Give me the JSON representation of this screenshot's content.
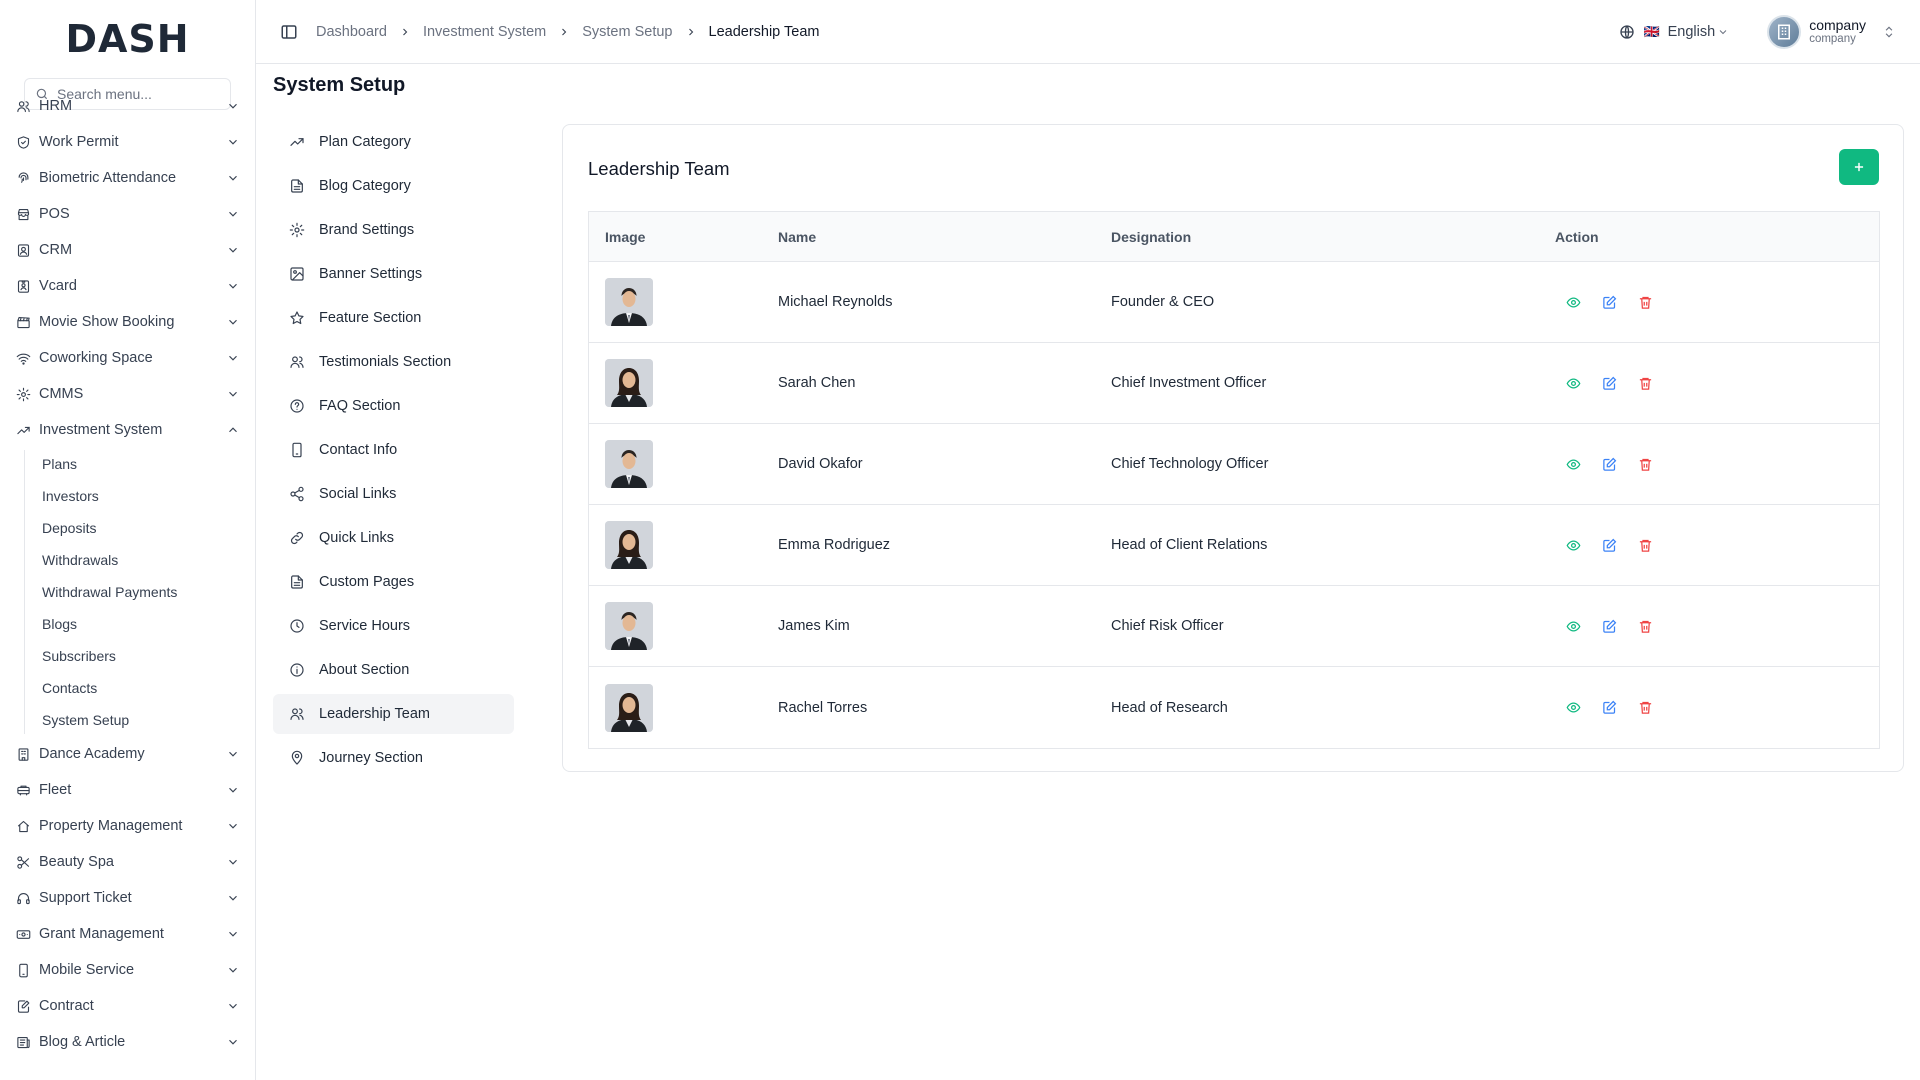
{
  "app": {
    "logo": "DASH",
    "search_placeholder": "Search menu..."
  },
  "sidebar": {
    "items": [
      {
        "label": "HRM",
        "icon": "users-icon"
      },
      {
        "label": "Work Permit",
        "icon": "shield-check-icon"
      },
      {
        "label": "Biometric Attendance",
        "icon": "fingerprint-icon"
      },
      {
        "label": "POS",
        "icon": "store-icon"
      },
      {
        "label": "CRM",
        "icon": "contact-icon"
      },
      {
        "label": "Vcard",
        "icon": "id-card-icon"
      },
      {
        "label": "Movie Show Booking",
        "icon": "clapper-icon"
      },
      {
        "label": "Coworking Space",
        "icon": "wifi-icon"
      },
      {
        "label": "CMMS",
        "icon": "gear-icon"
      },
      {
        "label": "Investment System",
        "icon": "trending-up-icon"
      },
      {
        "label": "Dance Academy",
        "icon": "building-icon"
      },
      {
        "label": "Fleet",
        "icon": "car-icon"
      },
      {
        "label": "Property Management",
        "icon": "home-icon"
      },
      {
        "label": "Beauty Spa",
        "icon": "scissors-icon"
      },
      {
        "label": "Support Ticket",
        "icon": "headphones-icon"
      },
      {
        "label": "Grant Management",
        "icon": "money-icon"
      },
      {
        "label": "Mobile Service",
        "icon": "phone-icon"
      },
      {
        "label": "Contract",
        "icon": "file-pen-icon"
      },
      {
        "label": "Blog & Article",
        "icon": "newspaper-icon"
      }
    ],
    "investment_sub": [
      "Plans",
      "Investors",
      "Deposits",
      "Withdrawals",
      "Withdrawal Payments",
      "Blogs",
      "Subscribers",
      "Contacts",
      "System Setup"
    ]
  },
  "header": {
    "breadcrumb": [
      "Dashboard",
      "Investment System",
      "System Setup",
      "Leadership Team"
    ],
    "language": "English",
    "flag": "🇬🇧",
    "company_name": "company",
    "company_sub": "company"
  },
  "page": {
    "title": "System Setup"
  },
  "settings_nav": [
    {
      "label": "Plan Category",
      "icon": "trending-up-icon"
    },
    {
      "label": "Blog Category",
      "icon": "file-text-icon"
    },
    {
      "label": "Brand Settings",
      "icon": "gear-icon"
    },
    {
      "label": "Banner Settings",
      "icon": "image-icon"
    },
    {
      "label": "Feature Section",
      "icon": "star-icon"
    },
    {
      "label": "Testimonials Section",
      "icon": "users-icon"
    },
    {
      "label": "FAQ Section",
      "icon": "help-circle-icon"
    },
    {
      "label": "Contact Info",
      "icon": "phone-icon"
    },
    {
      "label": "Social Links",
      "icon": "share-icon"
    },
    {
      "label": "Quick Links",
      "icon": "link-icon"
    },
    {
      "label": "Custom Pages",
      "icon": "file-text-icon"
    },
    {
      "label": "Service Hours",
      "icon": "clock-icon"
    },
    {
      "label": "About Section",
      "icon": "info-icon"
    },
    {
      "label": "Leadership Team",
      "icon": "users-icon"
    },
    {
      "label": "Journey Section",
      "icon": "map-pin-icon"
    }
  ],
  "card": {
    "title": "Leadership Team",
    "columns": [
      "Image",
      "Name",
      "Designation",
      "Action"
    ],
    "rows": [
      {
        "name": "Michael Reynolds",
        "designation": "Founder & CEO",
        "gender": "m"
      },
      {
        "name": "Sarah Chen",
        "designation": "Chief Investment Officer",
        "gender": "f"
      },
      {
        "name": "David Okafor",
        "designation": "Chief Technology Officer",
        "gender": "m"
      },
      {
        "name": "Emma Rodriguez",
        "designation": "Head of Client Relations",
        "gender": "f"
      },
      {
        "name": "James Kim",
        "designation": "Chief Risk Officer",
        "gender": "m"
      },
      {
        "name": "Rachel Torres",
        "designation": "Head of Research",
        "gender": "f"
      }
    ]
  },
  "colors": {
    "accent": "#10b981",
    "view": "#10b981",
    "edit": "#3b82f6",
    "delete": "#ef4444"
  }
}
